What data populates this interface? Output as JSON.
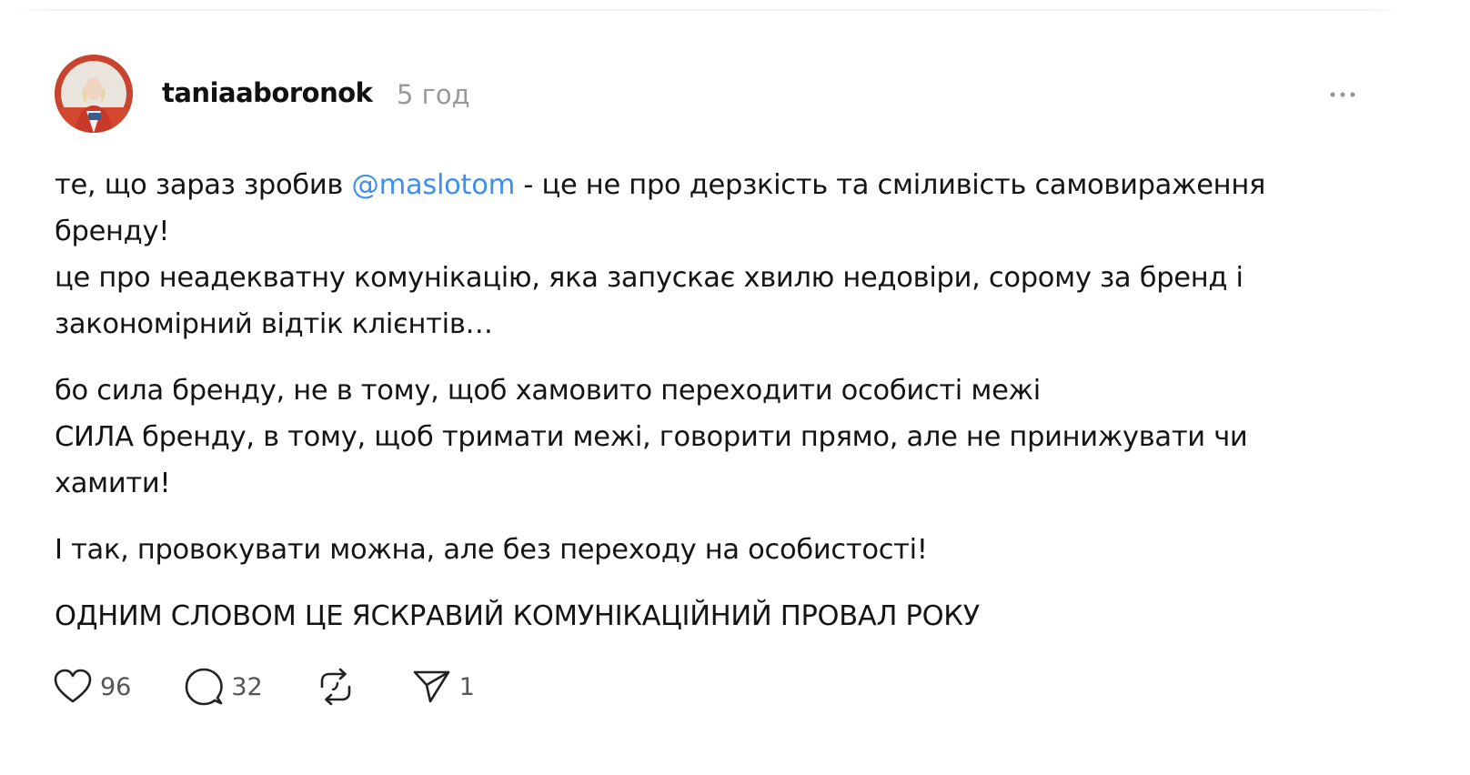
{
  "post": {
    "username": "taniaaboronok",
    "time_ago": "5 год",
    "paragraphs": [
      {
        "lines": [
          {
            "before": "те, що зараз зробив ",
            "mention": "@maslotom",
            "after": " - це не про дерзкість та сміливість самовираження"
          },
          {
            "text": "бренду!"
          },
          {
            "text": "це про неадекватну комунікацію, яка запускає хвилю недовіри, сорому за бренд і"
          },
          {
            "text": "закономірний відтік клієнтів…"
          }
        ]
      },
      {
        "lines": [
          {
            "text": "бо сила бренду, не в тому, щоб хамовито переходити особисті межі"
          },
          {
            "text": "СИЛА бренду, в тому, щоб тримати межі, говорити прямо, але не принижувати чи"
          },
          {
            "text": "хамити!"
          }
        ]
      },
      {
        "lines": [
          {
            "text": "І так, провокувати можна, але без переходу на особистості!"
          }
        ]
      },
      {
        "lines": [
          {
            "text": "ОДНИМ СЛОВОМ ЦЕ ЯСКРАВИЙ КОМУНІКАЦІЙНИЙ ПРОВАЛ РОКУ"
          }
        ]
      }
    ]
  },
  "actions": {
    "likes": "96",
    "replies": "32",
    "shares": "1"
  },
  "icons": {
    "like": "heart-icon",
    "reply": "speech-bubble-icon",
    "repost": "repost-icon",
    "share": "send-icon",
    "more": "more-horizontal-icon"
  },
  "colors": {
    "mention": "#3f8ff0",
    "muted": "#9a9a9a",
    "avatar_accent": "#c8442e"
  }
}
